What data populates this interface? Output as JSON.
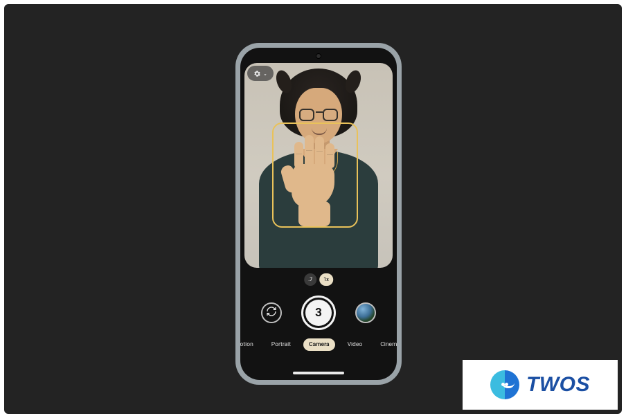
{
  "settings": {
    "icon": "gear-icon",
    "chevron": "chevron-down-icon"
  },
  "viewfinder": {
    "gesture_detection_box": true,
    "subject": "person-holding-palm-up"
  },
  "zoom": {
    "options": [
      {
        "label": ".7",
        "active": false
      },
      {
        "label": "1x",
        "active": true
      }
    ]
  },
  "controls": {
    "switch_camera": "switch-camera-icon",
    "shutter_countdown": "3",
    "gallery_thumb": "last-photo-thumbnail"
  },
  "modes": [
    {
      "label": "Motion",
      "active": false
    },
    {
      "label": "Portrait",
      "active": false
    },
    {
      "label": "Camera",
      "active": true
    },
    {
      "label": "Video",
      "active": false
    },
    {
      "label": "Cinemat",
      "active": false
    }
  ],
  "watermark": {
    "brand": "TWOS"
  }
}
